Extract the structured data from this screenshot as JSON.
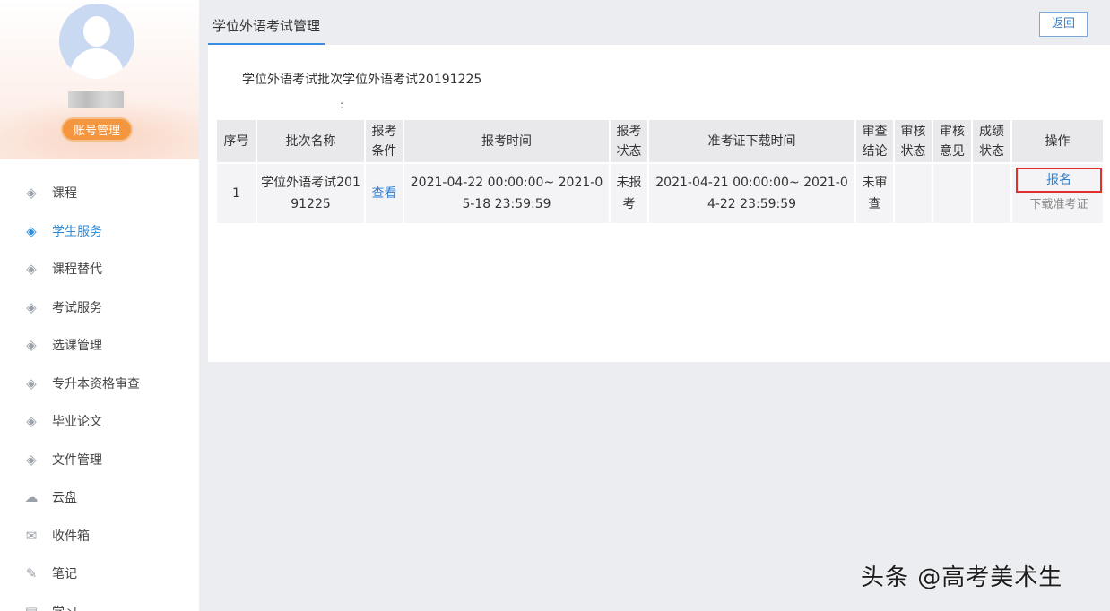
{
  "sidebar": {
    "account_button": "账号管理",
    "items": [
      {
        "label": "课程",
        "icon": "graduation-cap-icon"
      },
      {
        "label": "学生服务",
        "icon": "graduation-cap-icon"
      },
      {
        "label": "课程替代",
        "icon": "graduation-cap-icon"
      },
      {
        "label": "考试服务",
        "icon": "graduation-cap-icon"
      },
      {
        "label": "选课管理",
        "icon": "graduation-cap-icon"
      },
      {
        "label": "专升本资格审查",
        "icon": "graduation-cap-icon"
      },
      {
        "label": "毕业论文",
        "icon": "graduation-cap-icon"
      },
      {
        "label": "文件管理",
        "icon": "graduation-cap-icon"
      },
      {
        "label": "云盘",
        "icon": "cloud-icon"
      },
      {
        "label": "收件箱",
        "icon": "inbox-icon"
      },
      {
        "label": "笔记",
        "icon": "note-icon"
      },
      {
        "label": "学习",
        "icon": "book-icon"
      }
    ],
    "active_index": 1
  },
  "header": {
    "tab_title": "学位外语考试管理",
    "back_label": "返回"
  },
  "main": {
    "batch_line": "学位外语考试批次学位外语考试20191225",
    "colon_mark": ":",
    "table": {
      "columns": [
        "序号",
        "批次名称",
        "报考条件",
        "报考时间",
        "报考状态",
        "准考证下载时间",
        "审查结论",
        "审核状态",
        "审核意见",
        "成绩状态",
        "操作"
      ],
      "rows": [
        {
          "index": "1",
          "batch_name": "学位外语考试20191225",
          "condition": "查看",
          "apply_time": "2021-04-22 00:00:00~ 2021-05-18 23:59:59",
          "apply_status": "未报考",
          "ticket_time": "2021-04-21 00:00:00~ 2021-04-22 23:59:59",
          "review_result": "未审查",
          "audit_status": "",
          "audit_opinion": "",
          "score_status": "",
          "op_signup": "报名",
          "op_download": "下载准考证"
        }
      ]
    }
  },
  "watermark": "头条 @高考美术生",
  "colors": {
    "accent": "#2f8bd8",
    "highlight_box": "#e0302b",
    "account_button": "#f3963f"
  }
}
